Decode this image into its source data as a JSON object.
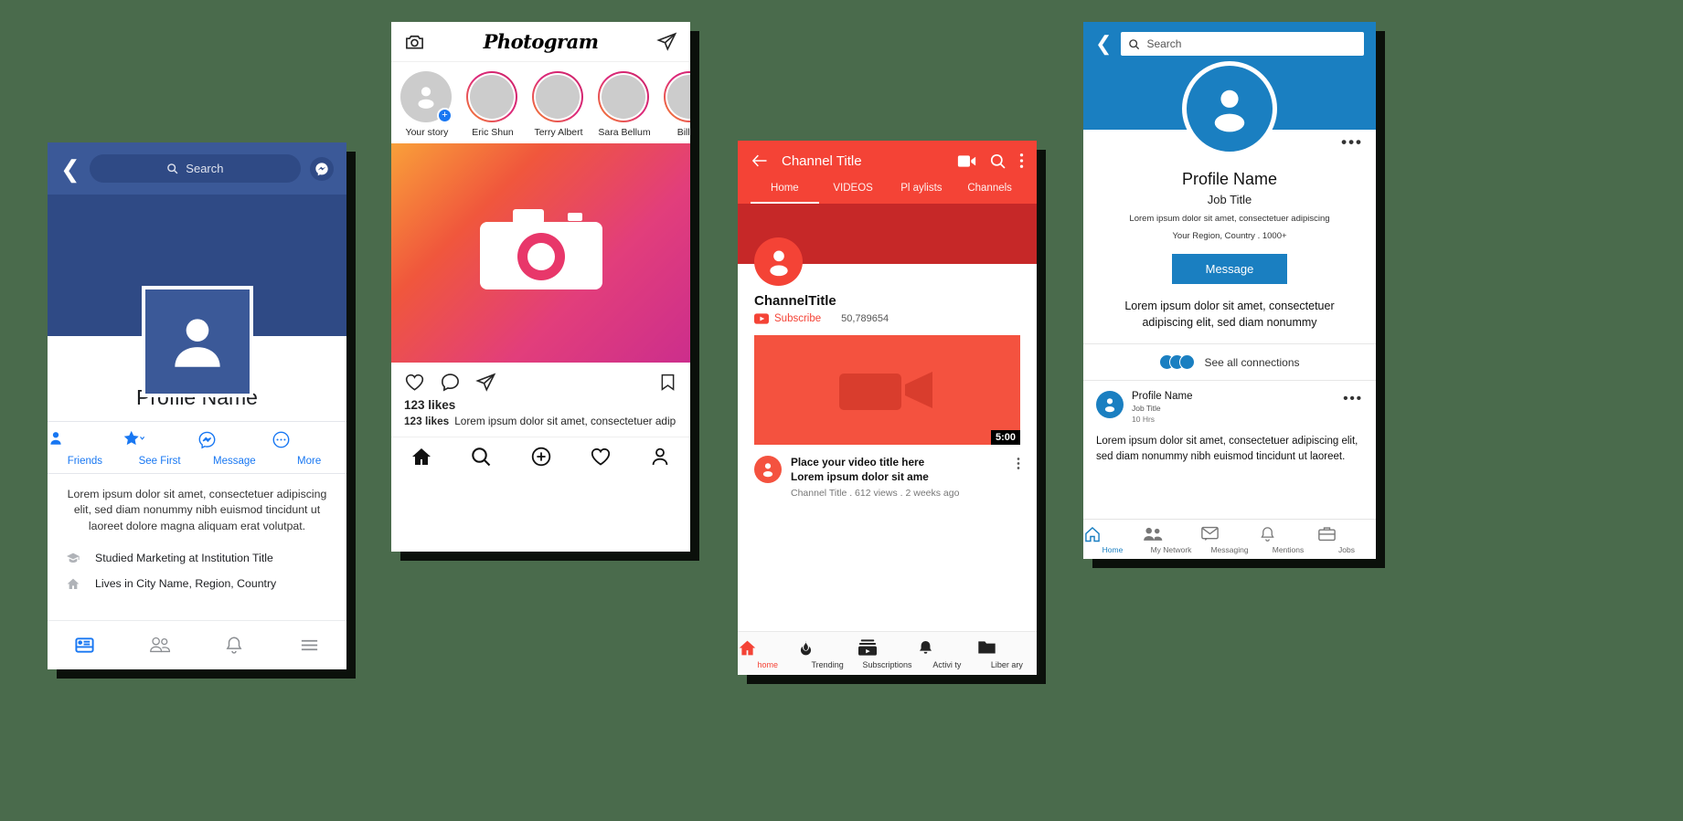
{
  "facebook": {
    "back_icon": "chevron-left-icon",
    "search": {
      "placeholder": "Search",
      "icon": "search-icon"
    },
    "messenger_icon": "messenger-icon",
    "avatar_icon": "person-avatar-icon",
    "profile_name": "Profile Name",
    "actions": [
      {
        "label": "Friends",
        "icon": "person-icon"
      },
      {
        "label": "See First",
        "icon": "star-icon"
      },
      {
        "label": "Message",
        "icon": "messenger-icon"
      },
      {
        "label": "More",
        "icon": "ellipsis-circle-icon"
      }
    ],
    "bio": "Lorem ipsum dolor sit amet, consectetuer adipiscing elit, sed diam nonummy nibh euismod tincidunt ut laoreet dolore magna aliquam erat volutpat.",
    "info": [
      {
        "icon": "graduation-cap-icon",
        "text": "Studied Marketing at Institution Title"
      },
      {
        "icon": "home-icon",
        "text": "Lives in City Name, Region, Country"
      }
    ],
    "nav": [
      {
        "icon": "newsfeed-icon",
        "active": true
      },
      {
        "icon": "friends-icon",
        "active": false
      },
      {
        "icon": "bell-icon",
        "active": false
      },
      {
        "icon": "hamburger-icon",
        "active": false
      }
    ],
    "colors": {
      "brand": "#3b5998",
      "accent": "#1877f2",
      "cover": "#2f4a85"
    }
  },
  "instagram": {
    "camera_icon": "camera-icon",
    "logo": "Photogram",
    "send_icon": "paper-plane-icon",
    "stories": [
      {
        "name": "Your story",
        "own": true
      },
      {
        "name": "Eric Shun",
        "own": false
      },
      {
        "name": "Terry Albert",
        "own": false
      },
      {
        "name": "Sara Bellum",
        "own": false
      },
      {
        "name": "Bill Ye",
        "own": false
      }
    ],
    "post_icon": "camera-photo-icon",
    "actions": [
      {
        "icon": "heart-icon"
      },
      {
        "icon": "comment-icon"
      },
      {
        "icon": "paper-plane-icon"
      },
      {
        "icon": "bookmark-icon"
      }
    ],
    "likes": "123 likes",
    "caption_user": "123 likes",
    "caption_text": "Lorem ipsum dolor sit amet, consectetuer adip",
    "nav": [
      {
        "icon": "home-icon",
        "active": true
      },
      {
        "icon": "search-icon",
        "active": false
      },
      {
        "icon": "plus-circle-icon",
        "active": false
      },
      {
        "icon": "heart-icon",
        "active": false
      },
      {
        "icon": "person-icon",
        "active": false
      }
    ],
    "colors": {
      "ring_start": "#f58529",
      "ring_end": "#cc2366"
    }
  },
  "youtube": {
    "back_icon": "arrow-left-icon",
    "title": "Channel Title",
    "header_icons": [
      {
        "icon": "video-camera-icon"
      },
      {
        "icon": "search-icon"
      },
      {
        "icon": "kebab-menu-icon"
      }
    ],
    "tabs": [
      {
        "label": "Home",
        "active": true
      },
      {
        "label": "VIDEOS",
        "active": false
      },
      {
        "label": "Pl aylists",
        "active": false
      },
      {
        "label": "Channels",
        "active": false
      }
    ],
    "channel_avatar_icon": "person-avatar-icon",
    "channel_name": "ChannelTitle",
    "subscribe_label": "Subscribe",
    "subscribe_icon": "youtube-play-icon",
    "subscriber_count": "50,789654",
    "video": {
      "thumb_icon": "video-camera-icon",
      "duration": "5:00",
      "avatar_icon": "person-avatar-icon",
      "title_line1": "Place your video title here",
      "title_line2": "Lorem ipsum dolor sit ame",
      "meta": "Channel Title . 612 views . 2 weeks ago",
      "menu_icon": "kebab-menu-icon"
    },
    "nav": [
      {
        "label": "home",
        "icon": "home-icon",
        "active": true
      },
      {
        "label": "Trending",
        "icon": "flame-icon",
        "active": false
      },
      {
        "label": "Subscriptions",
        "icon": "subscriptions-icon",
        "active": false
      },
      {
        "label": "Activi ty",
        "icon": "bell-icon",
        "active": false
      },
      {
        "label": "Liber ary",
        "icon": "folder-icon",
        "active": false
      }
    ],
    "colors": {
      "brand": "#f44336",
      "banner": "#c62828"
    }
  },
  "linkedin": {
    "back_icon": "chevron-left-icon",
    "search": {
      "placeholder": "Search",
      "icon": "search-icon"
    },
    "avatar_icon": "person-avatar-icon",
    "menu_icon": "ellipsis-icon",
    "profile_name": "Profile Name",
    "job_title": "Job Title",
    "description": "Lorem ipsum dolor sit amet, consectetuer adipiscing",
    "location": "Your Region, Country .  1000+",
    "message_button": "Message",
    "summary": "Lorem ipsum dolor sit amet, consectetuer adipiscing elit, sed diam nonummy",
    "connections_label": "See all connections",
    "feed": {
      "avatar_icon": "person-avatar-icon",
      "name": "Profile Name",
      "job": "Job Title",
      "time": "10 Hrs",
      "menu_icon": "ellipsis-icon",
      "body": "Lorem ipsum dolor sit amet, consectetuer adipiscing elit, sed diam nonummy nibh euismod tincidunt ut laoreet."
    },
    "nav": [
      {
        "label": "Home",
        "icon": "home-icon",
        "active": true
      },
      {
        "label": "My Network",
        "icon": "network-icon",
        "active": false
      },
      {
        "label": "Messaging",
        "icon": "messaging-icon",
        "active": false
      },
      {
        "label": "Mentions",
        "icon": "bell-icon",
        "active": false
      },
      {
        "label": "Jobs",
        "icon": "briefcase-icon",
        "active": false
      }
    ],
    "colors": {
      "brand": "#1a7fc1"
    }
  }
}
